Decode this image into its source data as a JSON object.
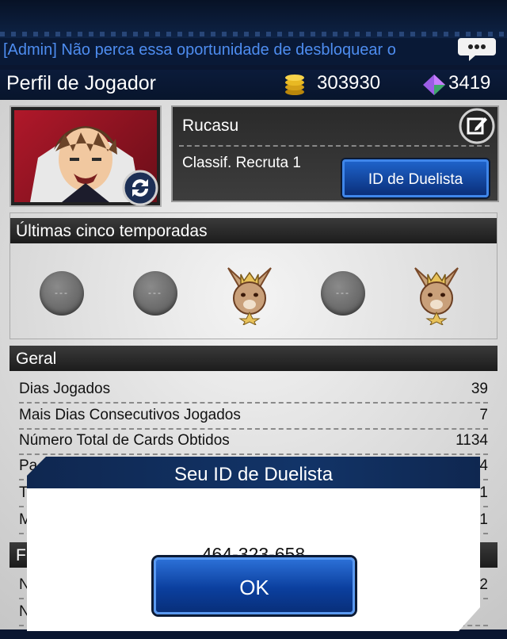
{
  "ticker": {
    "text": "[Admin] Não perca essa oportunidade de desbloquear o"
  },
  "header": {
    "title": "Perfil de Jogador",
    "gold": "303930",
    "gems": "3419"
  },
  "profile": {
    "name": "Rucasu",
    "rank": "Classif. Recruta 1",
    "id_button": "ID de Duelista"
  },
  "seasons": {
    "title": "Últimas cinco temporadas",
    "medals": [
      "---",
      "---",
      "crown-rabbit",
      "---",
      "crown-rabbit"
    ]
  },
  "general": {
    "title": "Geral",
    "rows": [
      {
        "label": "Dias Jogados",
        "value": "39"
      },
      {
        "label": "Mais Dias Consecutivos Jogados",
        "value": "7"
      },
      {
        "label": "Número Total de Cards Obtidos",
        "value": "1134"
      }
    ],
    "partial_rows": [
      {
        "label": "Pa",
        "value": "4"
      },
      {
        "label": "T",
        "value": "1"
      },
      {
        "label": "M",
        "value": "1"
      }
    ],
    "next_section_initial": "F",
    "partial_rows_2": [
      {
        "label": "N",
        "value": "2"
      },
      {
        "label": "N",
        "value": ""
      }
    ]
  },
  "dialog": {
    "title": "Seu ID de Duelista",
    "duelist_id": "464-323-658",
    "ok_label": "OK"
  },
  "colors": {
    "accent": "#1e62c9",
    "ticker": "#4e8df0",
    "header_bg": "#0b1b3a"
  }
}
